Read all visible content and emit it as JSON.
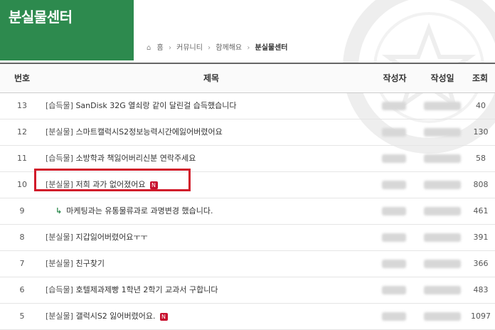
{
  "header": {
    "title": "분실물센터",
    "breadcrumb": [
      "홈",
      "커뮤니티",
      "함께해요",
      "분실물센터"
    ]
  },
  "table": {
    "columns": [
      "번호",
      "제목",
      "작성자",
      "작성일",
      "조회"
    ],
    "rows": [
      {
        "num": "13",
        "category": "[습득물]",
        "title": "SanDisk 32G 열쇠랑 같이 달린걸 습득했습니다",
        "views": "40",
        "new": false,
        "reply": false
      },
      {
        "num": "12",
        "category": "[분실물]",
        "title": "스마트캘럭시S2정보능력시간에잃어버렸어요",
        "views": "130",
        "new": false,
        "reply": false
      },
      {
        "num": "11",
        "category": "[습득물]",
        "title": "소방학과 책잃어버리신분 연락주세요",
        "views": "58",
        "new": false,
        "reply": false
      },
      {
        "num": "10",
        "category": "[분실물]",
        "title": "저희 과가 없어졌어요",
        "views": "808",
        "new": true,
        "reply": false
      },
      {
        "num": "9",
        "category": "",
        "title": "마케팅과는 유통물류과로 과명변경 했습니다.",
        "views": "461",
        "new": false,
        "reply": true
      },
      {
        "num": "8",
        "category": "[분실물]",
        "title": "지갑잃어버렸어요ㅜㅜ",
        "views": "391",
        "new": false,
        "reply": false
      },
      {
        "num": "7",
        "category": "[분실물]",
        "title": "친구찾기",
        "views": "366",
        "new": false,
        "reply": false
      },
      {
        "num": "6",
        "category": "[습득물]",
        "title": "호텔제과제빵 1학년 2학기 교과서 구합니다",
        "views": "483",
        "new": false,
        "reply": false
      },
      {
        "num": "5",
        "category": "[분실물]",
        "title": "갤럭시S2 잃어버렸어요.",
        "views": "1097",
        "new": true,
        "reply": false
      }
    ]
  },
  "badge": {
    "new_label": "N"
  },
  "colors": {
    "brand": "#2d8a4e",
    "highlight": "#d11a2a",
    "new_badge": "#c8102e"
  },
  "icons": {
    "home": "home-icon",
    "reply": "reply-arrow-icon"
  }
}
